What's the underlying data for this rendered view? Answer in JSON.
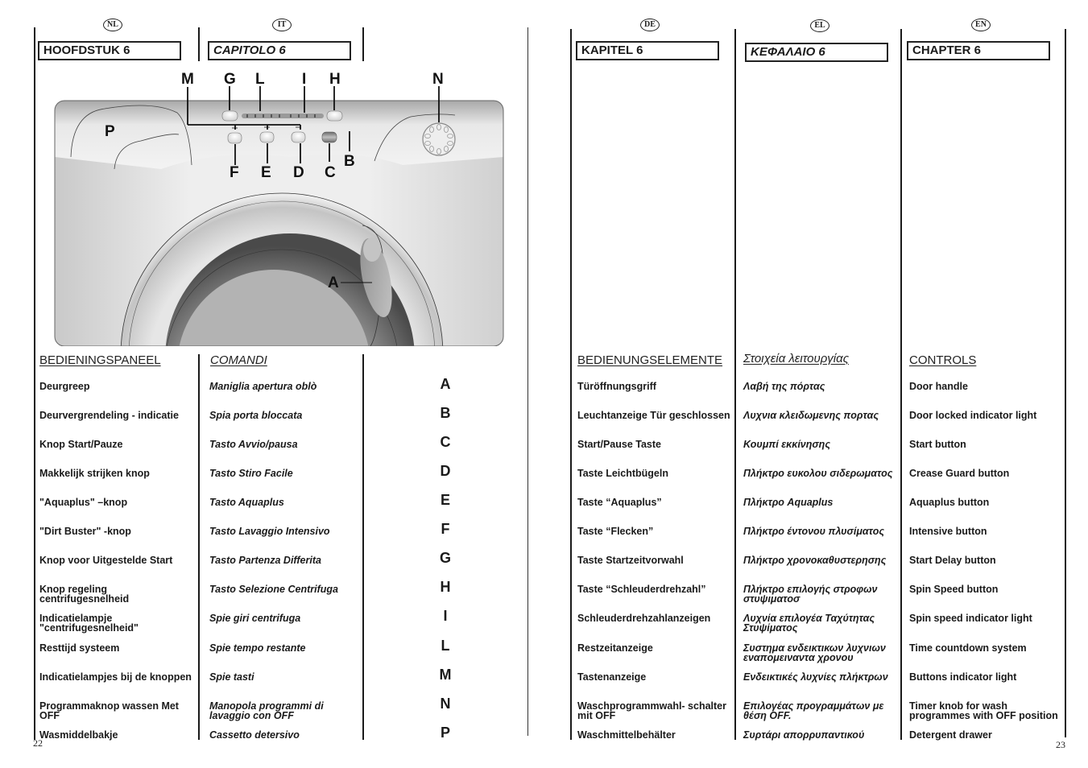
{
  "pages": {
    "left_number": "22",
    "right_number": "23"
  },
  "columns": [
    {
      "lang": "NL",
      "chapter": "HOOFDSTUK 6",
      "section": "BEDIENINGSPANEEL",
      "items": [
        "Deurgreep",
        "Deurvergrendeling - indicatie",
        "Knop Start/Pauze",
        "Makkelijk strijken knop",
        "\"Aquaplus\" –knop",
        "\"Dirt Buster\" -knop",
        "Knop voor Uitgestelde Start",
        "Knop regeling centrifugesnelheid",
        "Indicatielampje \"centrifugesnelheid\"",
        "Resttijd systeem",
        "Indicatielampjes bij de knoppen",
        "Programmaknop wassen Met OFF",
        "Wasmiddelbakje"
      ]
    },
    {
      "lang": "IT",
      "chapter": "CAPITOLO 6",
      "section": "COMANDI",
      "items": [
        "Maniglia apertura oblò",
        "Spia porta bloccata",
        "Tasto Avvio/pausa",
        "Tasto Stiro Facile",
        "Tasto Aquaplus",
        "Tasto Lavaggio Intensivo",
        "Tasto Partenza Differita",
        "Tasto Selezione Centrifuga",
        "Spie giri centrifuga",
        "Spie tempo restante",
        "Spie tasti",
        "Manopola programmi di lavaggio con OFF",
        "Cassetto detersivo"
      ]
    },
    {
      "lang": "DE",
      "chapter": "KAPITEL 6",
      "section": "BEDIENUNGSELEMENTE",
      "items": [
        "Türöffnungsgriff",
        "Leuchtanzeige Tür geschlossen",
        "Start/Pause Taste",
        "Taste Leichtbügeln",
        "Taste “Aquaplus”",
        "Taste “Flecken”",
        "Taste Startzeitvorwahl",
        "Taste “Schleuderdrehzahl”",
        "Schleuderdrehzahlanzeigen",
        "Restzeitanzeige",
        "Tastenanzeige",
        "Waschprogrammwahl- schalter mit OFF",
        "Waschmittelbehälter"
      ]
    },
    {
      "lang": "EL",
      "chapter": "ΚΕΦΑΛΑΙΟ 6",
      "section": "Στοιχεία λειτουργίας",
      "items": [
        "Λαβή της πόρτας",
        "Λυχνια κλειδωμενης πορτας",
        "Κουμπί εκκίνησης",
        "Πλήκτρο ευκολου σιδερωματος",
        "Πλήκτρο Aquaplus",
        "Πλήκτρο έντονου πλυσίματος",
        "Πλήκτρο χρονοκαθυστερησης",
        "Πλήκτρο επιλογής στροφων στυψιματοσ",
        "Λυχνία επιλογέα Ταχύτητας Στυψίματος",
        "Συστημα ενδεικτικων λυχνιων εναπομειναντα χρονου",
        "Ενδεικτικές λυχνίες πλήκτρων",
        "Επιλογέας προγραμμάτων με θέση OFF.",
        "Συρτάρι απορρυπαντικού"
      ]
    },
    {
      "lang": "EN",
      "chapter": "CHAPTER 6",
      "section": "CONTROLS",
      "items": [
        "Door handle",
        "Door locked indicator light",
        "Start button",
        "Crease Guard button",
        "Aquaplus button",
        "Intensive button",
        "Start Delay button",
        "Spin Speed button",
        "Spin speed indicator light",
        "Time countdown system",
        "Buttons indicator light",
        "Timer knob for wash programmes with OFF position",
        "Detergent drawer"
      ]
    }
  ],
  "letters": [
    "A",
    "B",
    "C",
    "D",
    "E",
    "F",
    "G",
    "H",
    "I",
    "L",
    "M",
    "N",
    "P"
  ],
  "diagram": {
    "labels": {
      "M": "M",
      "G": "G",
      "L": "L",
      "I": "I",
      "H": "H",
      "N": "N",
      "P": "P",
      "F": "F",
      "E": "E",
      "D": "D",
      "C": "C",
      "B": "B",
      "A": "A"
    }
  }
}
